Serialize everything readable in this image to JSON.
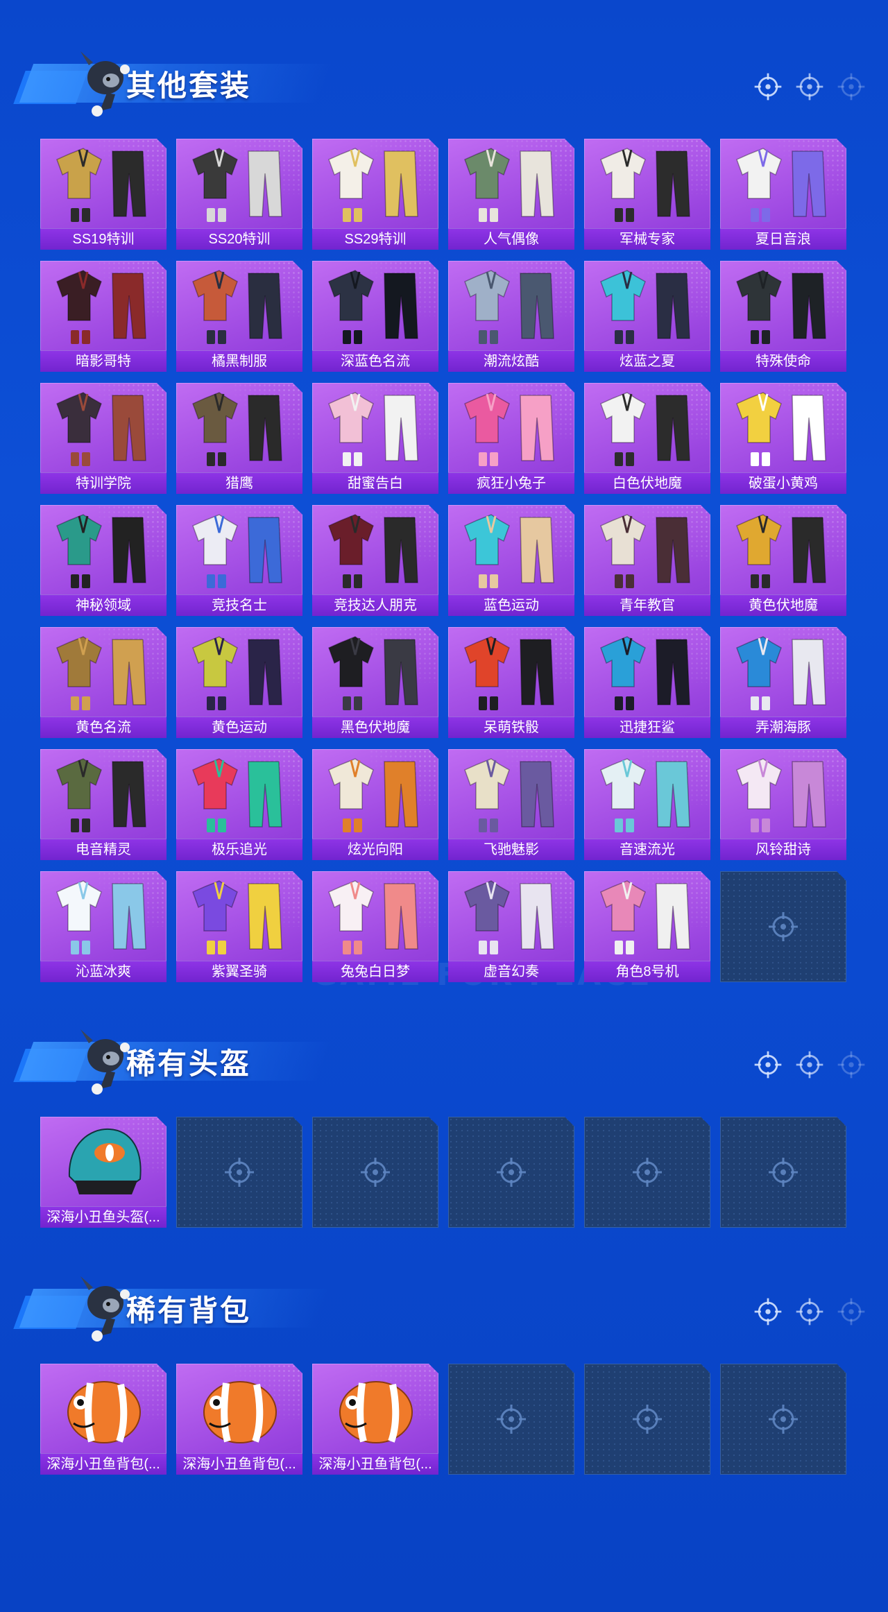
{
  "watermark": "GAME FOR PEACE",
  "sections": [
    {
      "title": "其他套装",
      "items": [
        "SS19特训",
        "SS20特训",
        "SS29特训",
        "人气偶像",
        "军械专家",
        "夏日音浪",
        "暗影哥特",
        "橘黑制服",
        "深蓝色名流",
        "潮流炫酷",
        "炫蓝之夏",
        "特殊使命",
        "特训学院",
        "猎鹰",
        "甜蜜告白",
        "疯狂小兔子",
        "白色伏地魔",
        "破蛋小黄鸡",
        "神秘领域",
        "竞技名士",
        "竞技达人朋克",
        "蓝色运动",
        "青年教官",
        "黄色伏地魔",
        "黄色名流",
        "黄色运动",
        "黑色伏地魔",
        "呆萌铁骰",
        "迅捷狂鲨",
        "弄潮海豚",
        "电音精灵",
        "极乐追光",
        "炫光向阳",
        "飞驰魅影",
        "音速流光",
        "风铃甜诗",
        "沁蓝冰爽",
        "紫翼圣骑",
        "兔兔白日梦",
        "虚音幻奏",
        "角色8号机"
      ],
      "empty_slots": 1
    },
    {
      "title": "稀有头盔",
      "items": [
        "深海小丑鱼头盔(..."
      ],
      "empty_slots": 5
    },
    {
      "title": "稀有背包",
      "items": [
        "深海小丑鱼背包(...",
        "深海小丑鱼背包(...",
        "深海小丑鱼背包(..."
      ],
      "empty_slots": 3
    }
  ],
  "colors": {
    "background": "#0b4ad0",
    "card": "#a14fe4",
    "card_label": "#7a28d3",
    "empty_slot": "#1f3f72"
  },
  "icons": [
    "mascot-icon",
    "crosshair-icon",
    "outfit-icon",
    "helmet-icon",
    "backpack-icon"
  ]
}
